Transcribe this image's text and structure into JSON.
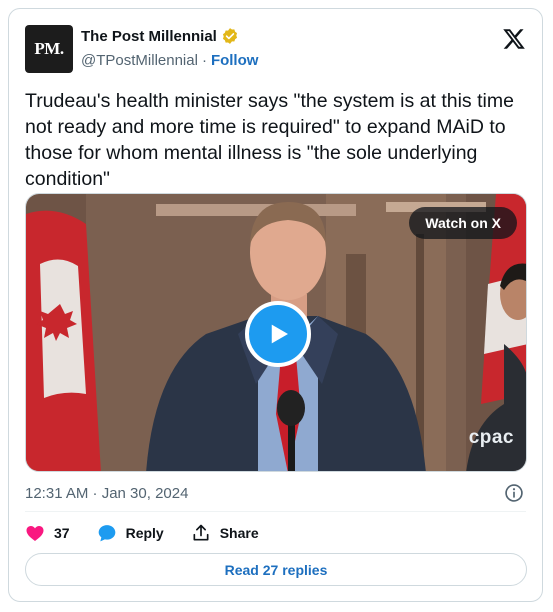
{
  "author": {
    "avatar_text": "PM.",
    "name": "The Post Millennial",
    "handle": "@TPostMillennial",
    "separator": "·",
    "follow_label": "Follow"
  },
  "tweet": {
    "text": "Trudeau's health minister says \"the system is at this time not ready and more time is required\" to expand MAiD to those for whom mental illness is \"the sole underlying condition\""
  },
  "media": {
    "watch_label": "Watch on X",
    "watermark": "cpac"
  },
  "timestamp": "12:31 AM · Jan 30, 2024",
  "actions": {
    "like_count": "37",
    "reply_label": "Reply",
    "share_label": "Share"
  },
  "read_replies_label": "Read 27 replies",
  "icons": {
    "verified": "verified-badge-icon",
    "x_logo": "x-logo-icon",
    "play": "play-icon",
    "info": "info-icon",
    "heart": "heart-icon",
    "reply": "reply-bubble-icon",
    "share": "share-icon"
  },
  "colors": {
    "accent": "#1d9bf0",
    "link": "#1d6fbf",
    "heart": "#f91880",
    "verified_gold": "#e2b719"
  }
}
